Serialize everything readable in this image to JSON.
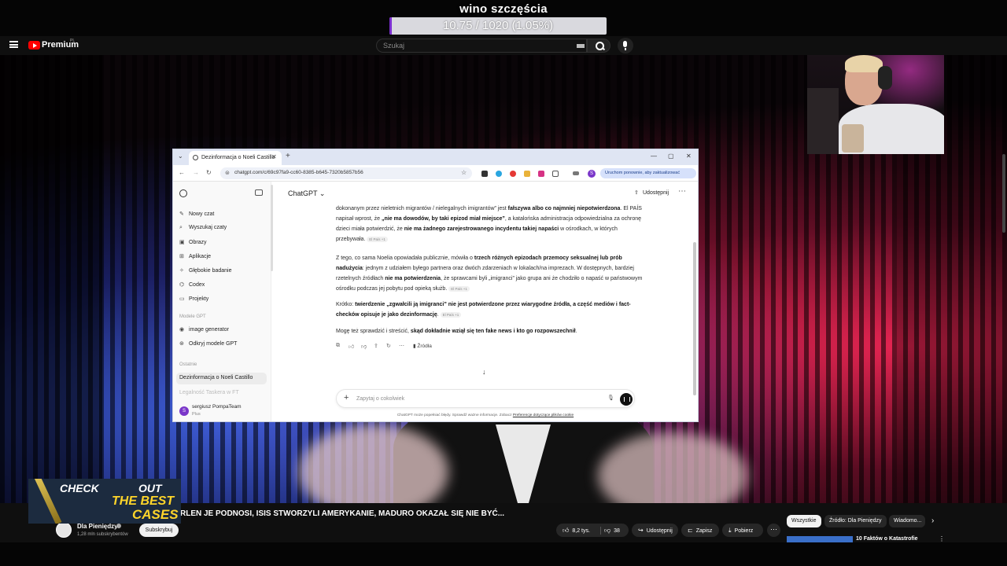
{
  "stream": {
    "goal_title": "wino szczęścia",
    "goal_progress_text": "10.75 / 1020 (1.05%)",
    "goal_progress_fraction": 0.0105,
    "goal_color": "#7c2fd0"
  },
  "youtube": {
    "brand": "Premium",
    "region": "PL",
    "search_placeholder": "Szukaj",
    "icons": {
      "menu": "hamburger-icon",
      "search": "search-icon",
      "voice": "mic-icon",
      "keyboard": "keyboard-icon"
    }
  },
  "browser": {
    "tab_title": "Dezinformacja o Noeli Castillo",
    "url": "chatgpt.com/c/69c97fa9-cc60-8385-b645-7320b5857b56",
    "profile_letter": "S",
    "update_label": "Uruchom ponownie, aby zaktualizować"
  },
  "sidebar": {
    "items": [
      {
        "label": "Nowy czat",
        "icon": "new-chat-icon",
        "glyph": "✎"
      },
      {
        "label": "Wyszukaj czaty",
        "icon": "search-icon",
        "glyph": "⌕"
      },
      {
        "label": "Obrazy",
        "icon": "image-icon",
        "glyph": "▣"
      },
      {
        "label": "Aplikacje",
        "icon": "apps-icon",
        "glyph": "⊞"
      },
      {
        "label": "Głębokie badanie",
        "icon": "research-icon",
        "glyph": "✧"
      },
      {
        "label": "Codex",
        "icon": "codex-icon",
        "glyph": "⌬"
      },
      {
        "label": "Projekty",
        "icon": "folder-icon",
        "glyph": "▭"
      }
    ],
    "gpts_heading": "Modele GPT",
    "gpts": [
      {
        "label": "image generator",
        "glyph": "◉"
      },
      {
        "label": "Odkryj modele GPT",
        "glyph": "⊛"
      }
    ],
    "recent_heading": "Ostatnie",
    "recent_chats": [
      "Dezinformacja o Noeli Castillo",
      "Legalność Taskera w FT"
    ],
    "user_name": "sergiusz PompaTeam",
    "user_plan": "Plus",
    "user_initial": "S"
  },
  "chat": {
    "model": "ChatGPT ⌄",
    "share": "Udostępnij",
    "para1": [
      {
        "t": "dokonanym przez nieletnich migrantów / nielegalnych imigrantów” jest "
      },
      {
        "t": "fałszywa albo co najmniej niepotwierdzona",
        "b": true
      },
      {
        "t": ". El PAÍS napisał wprost, że "
      },
      {
        "t": "„nie ma dowodów, by taki epizod miał miejsce”",
        "b": true
      },
      {
        "t": ", a katalońska administracja odpowiedzialna za ochronę dzieci miała potwierdzić, że "
      },
      {
        "t": "nie ma żadnego zarejestrowanego incydentu takiej napaści",
        "b": true
      },
      {
        "t": " w ośrodkach, w których przebywała. "
      },
      {
        "chip": "El País +1"
      }
    ],
    "para2": [
      {
        "t": "Z tego, co sama Noelia opowiadała publicznie, mówiła o "
      },
      {
        "t": "trzech różnych epizodach przemocy seksualnej lub prób nadużycia",
        "b": true
      },
      {
        "t": ": jednym z udziałem byłego partnera oraz dwóch zdarzeniach w lokalach/na imprezach. W dostępnych, bardziej rzetelnych źródłach "
      },
      {
        "t": "nie ma potwierdzenia",
        "b": true
      },
      {
        "t": ", że sprawcami byli „imigranci” jako grupa ani że chodziło o napaść w państwowym ośrodku podczas jej pobytu pod opieką służb. "
      },
      {
        "chip": "El País +1"
      }
    ],
    "para3": [
      {
        "t": "Krótko: "
      },
      {
        "t": "twierdzenie „zgwałcili ją imigranci” nie jest potwierdzone przez wiarygodne źródła, a część mediów i fact-checków opisuje je jako dezinformację",
        "b": true
      },
      {
        "t": ". "
      },
      {
        "chip": "El País +1"
      }
    ],
    "para4": [
      {
        "t": "Mogę też sprawdzić i streścić, "
      },
      {
        "t": "skąd dokładnie wziął się ten fake news i kto go rozpowszechnił",
        "b": true
      },
      {
        "t": "."
      }
    ],
    "sources_label": "Źródła",
    "composer_placeholder": "Zapytaj o cokolwiek",
    "disclaimer": "ChatGPT może popełniać błędy. Sprawdź ważne informacje. Zobacz",
    "disclaimer_link": "Preferencje dotyczące plików cookie",
    "action_icons": [
      "copy-icon",
      "thumbs-up-icon",
      "thumbs-down-icon",
      "share-icon",
      "regenerate-icon",
      "more-icon"
    ]
  },
  "promo": {
    "line1": "CHECK",
    "line2": "OUT",
    "line3": "THE BEST",
    "line4": "CASES"
  },
  "video": {
    "title": "RLEN JE PODNOSI, ISIS STWORZYLI AMERYKANIE, MADURO OKAZAŁ SIĘ NIE BYĆ...",
    "channel": "Dla Pieniędzy",
    "subscribers": "1,28 mln subskrybentów",
    "subscribe": "Subskrybuj",
    "likes": "8,2 tys.",
    "dislikes": "38",
    "share": "Udostępnij",
    "save": "Zapisz",
    "download": "Pobierz"
  },
  "recommendations": {
    "chips": [
      "Wszystkie",
      "Źródło: Dla Pieniędzy",
      "Wiadomo..."
    ],
    "first_title": "10 Faktów o Katastrofie"
  }
}
